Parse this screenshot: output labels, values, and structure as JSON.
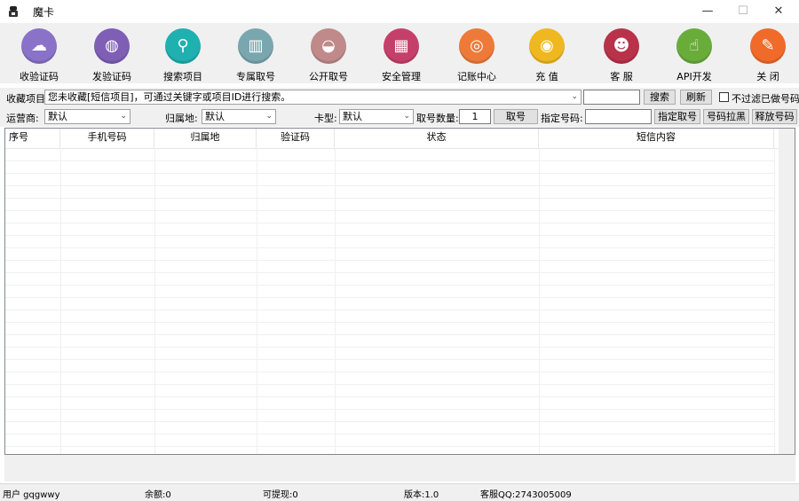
{
  "window": {
    "title": "魔卡",
    "minimize": "—",
    "maximize": "☐",
    "close": "✕"
  },
  "toolbar": [
    {
      "label": "收验证码",
      "icon": "inbox-icon",
      "glyph": "☁",
      "color": "#8a72c8"
    },
    {
      "label": "发验证码",
      "icon": "globe-icon",
      "glyph": "◍",
      "color": "#7e5fb5"
    },
    {
      "label": "搜索项目",
      "icon": "search-icon",
      "glyph": "⚲",
      "color": "#1fb0b0"
    },
    {
      "label": "专属取号",
      "icon": "cards-icon",
      "glyph": "▥",
      "color": "#7aa6b0"
    },
    {
      "label": "公开取号",
      "icon": "bowl-icon",
      "glyph": "◒",
      "color": "#c08a8a"
    },
    {
      "label": "安全管理",
      "icon": "shop-icon",
      "glyph": "▦",
      "color": "#c4406a"
    },
    {
      "label": "记账中心",
      "icon": "target-icon",
      "glyph": "◎",
      "color": "#ee7a3a"
    },
    {
      "label": "充  值",
      "icon": "coin-icon",
      "glyph": "◉",
      "color": "#f0b820"
    },
    {
      "label": "客  服",
      "icon": "people-icon",
      "glyph": "☻",
      "color": "#b8324a"
    },
    {
      "label": "API开发",
      "icon": "thumbs-up-icon",
      "glyph": "☝",
      "color": "#6aac3a"
    },
    {
      "label": "关  闭",
      "icon": "close-tool-icon",
      "glyph": "✎",
      "color": "#f06a2a"
    }
  ],
  "project_row": {
    "label": "收藏项目",
    "select_value": "您未收藏[短信项目]，可通过关键字或项目ID进行搜索。",
    "search_value": "",
    "search_button": "搜索",
    "refresh_button": "刷新",
    "filter_label": "不过滤已做号码"
  },
  "filter_row": {
    "carrier_label": "运营商:",
    "carrier_value": "默认",
    "region_label": "归属地:",
    "region_value": "默认",
    "cardtype_label": "卡型:",
    "cardtype_value": "默认",
    "count_label": "取号数量:",
    "count_value": "1",
    "fetch_button": "取号",
    "assign_label": "指定号码:",
    "assign_value": "",
    "assign_button": "指定取号",
    "blacklist_button": "号码拉黑",
    "release_button": "释放号码"
  },
  "table": {
    "columns": [
      "序号",
      "手机号码",
      "归属地",
      "验证码",
      "状态",
      "短信内容"
    ],
    "rows": []
  },
  "status": {
    "user": "用户 gqgwwy",
    "balance": "余额:0",
    "withdrawable": "可提现:0",
    "version": "版本:1.0",
    "support_qq": "客服QQ:2743005009"
  }
}
